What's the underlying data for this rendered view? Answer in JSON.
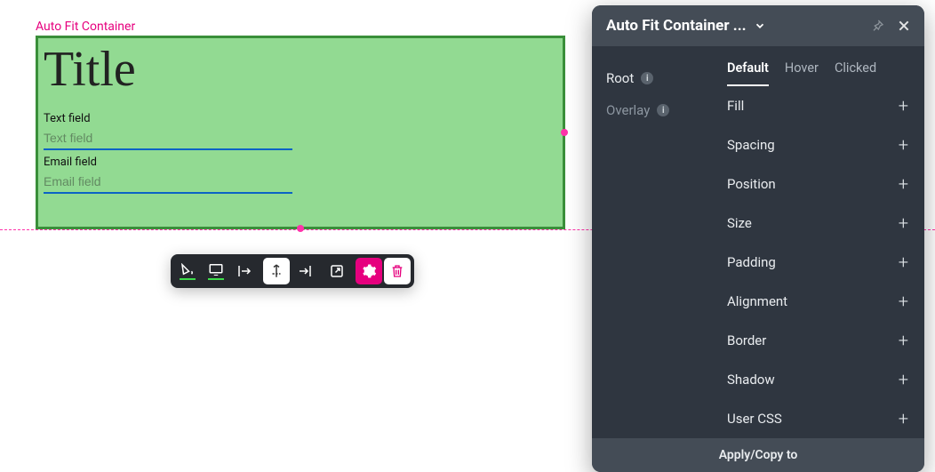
{
  "canvas": {
    "component_label": "Auto Fit Container",
    "title": "Title",
    "text_field": {
      "label": "Text field",
      "placeholder": "Text field"
    },
    "email_field": {
      "label": "Email field",
      "placeholder": "Email field"
    }
  },
  "toolbar": {
    "items": [
      "fill-icon",
      "display-icon",
      "align-start-icon",
      "align-vertical-icon",
      "align-end-icon",
      "open-external-icon",
      "settings-icon",
      "delete-icon"
    ]
  },
  "panel": {
    "title": "Auto Fit Container ...",
    "nav": {
      "root": "Root",
      "overlay": "Overlay"
    },
    "tabs": {
      "default": "Default",
      "hover": "Hover",
      "clicked": "Clicked"
    },
    "props": {
      "fill": "Fill",
      "spacing": "Spacing",
      "position": "Position",
      "size": "Size",
      "padding": "Padding",
      "alignment": "Alignment",
      "border": "Border",
      "shadow": "Shadow",
      "usercss": "User CSS"
    },
    "footer": "Apply/Copy to"
  }
}
